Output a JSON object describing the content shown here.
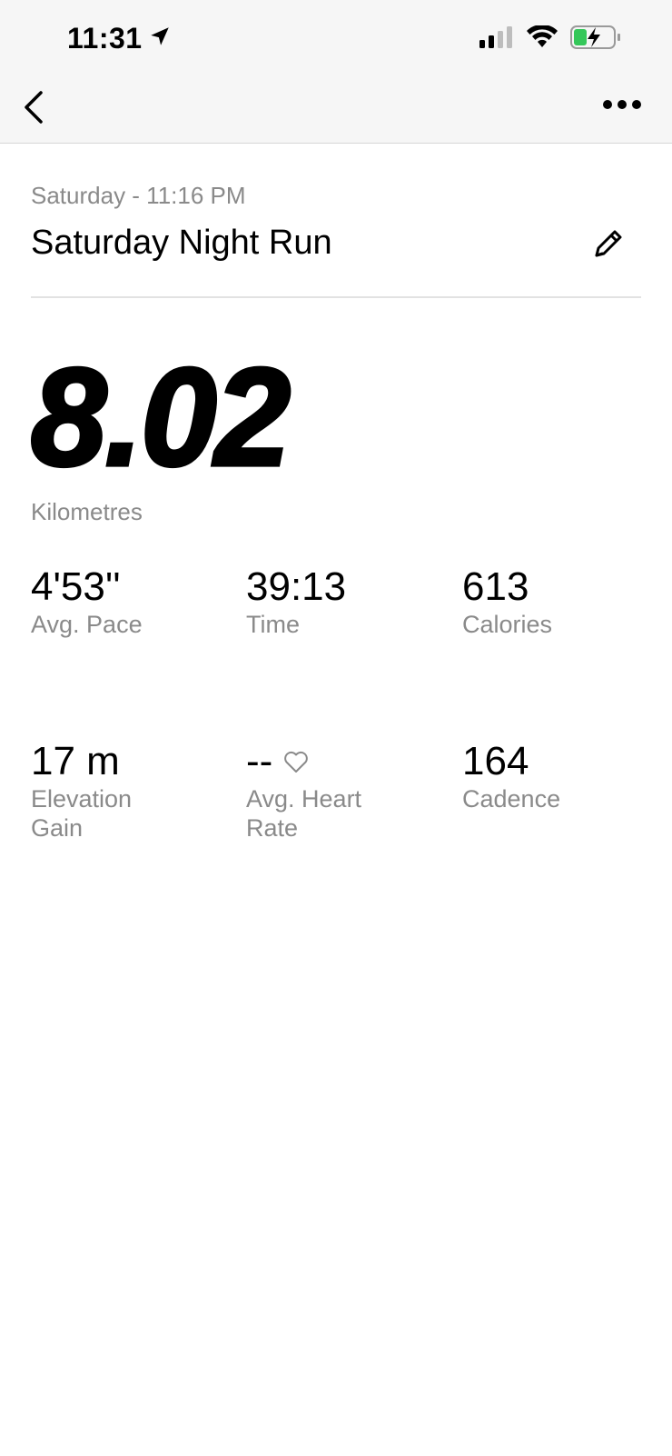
{
  "status_bar": {
    "time": "11:31",
    "location_icon": "location-arrow-icon",
    "signal_icon": "cellular-signal-icon",
    "wifi_icon": "wifi-icon",
    "battery_icon": "battery-charging-icon",
    "battery_color": "#34c759"
  },
  "nav": {
    "back_icon": "chevron-left-icon",
    "more_icon": "ellipsis-icon"
  },
  "activity": {
    "date_line": "Saturday - 11:16 PM",
    "title": "Saturday Night Run",
    "edit_icon": "pencil-icon",
    "distance": "8.02",
    "distance_unit": "Kilometres"
  },
  "stats": [
    {
      "value": "4'53''",
      "label": "Avg. Pace"
    },
    {
      "value": "39:13",
      "label": "Time"
    },
    {
      "value": "613",
      "label": "Calories"
    },
    {
      "value": "17 m",
      "label": "Elevation Gain"
    },
    {
      "value": "--",
      "label": "Avg. Heart Rate",
      "icon": "heart-outline-icon"
    },
    {
      "value": "164",
      "label": "Cadence"
    }
  ],
  "colors": {
    "text_primary": "#000000",
    "text_secondary": "#8a8a8a",
    "divider": "#e2e2e2",
    "topbar_bg": "#f6f6f6"
  }
}
